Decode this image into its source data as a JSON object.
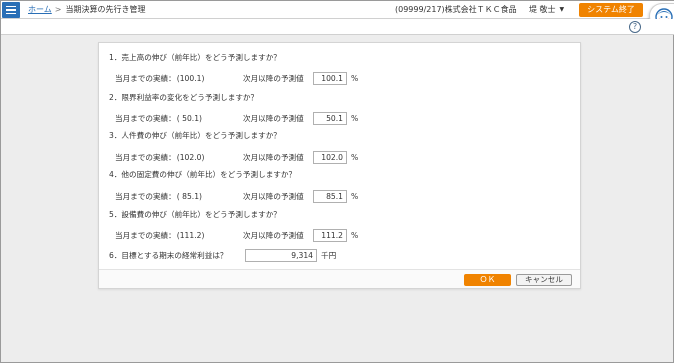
{
  "header": {
    "menu_icon": "hamburger-icon",
    "breadcrumb_home": "ホーム",
    "breadcrumb_separator": ">",
    "breadcrumb_current": "当期決算の先行き管理",
    "company": "(09999/217)株式会社ＴＫＣ食品",
    "user_name": "堤 敬士",
    "user_caret_icon": "caret-down-icon",
    "exit_label": "システム終了",
    "mascot_icon": "assistant-mascot-icon",
    "help_icon": "question-icon",
    "help_glyph": "?",
    "accent_color": "#2a6fb6",
    "exit_color": "#f08300"
  },
  "dialog": {
    "actual_label": "当月までの実績：",
    "forecast_label": "次月以降の予測値",
    "percent_unit": "%",
    "questions": [
      {
        "title": "1．売上高の伸び（前年比）をどう予測しますか？",
        "actual": "(100.1)",
        "forecast": "100.1"
      },
      {
        "title": "2．限界利益率の変化をどう予測しますか？",
        "actual": "( 50.1)",
        "forecast": "50.1"
      },
      {
        "title": "3．人件費の伸び（前年比）をどう予測しますか？",
        "actual": "(102.0)",
        "forecast": "102.0"
      },
      {
        "title": "4．他の固定費の伸び（前年比）をどう予測しますか？",
        "actual": "( 85.1)",
        "forecast": "85.1"
      },
      {
        "title": "5．設備費の伸び（前年比）をどう予測しますか？",
        "actual": "(111.2)",
        "forecast": "111.2"
      }
    ],
    "target": {
      "title": "6．目標とする期末の経常利益は？",
      "value": "9,314",
      "unit": "千円"
    },
    "ok_label": "ＯＫ",
    "cancel_label": "キャンセル"
  }
}
